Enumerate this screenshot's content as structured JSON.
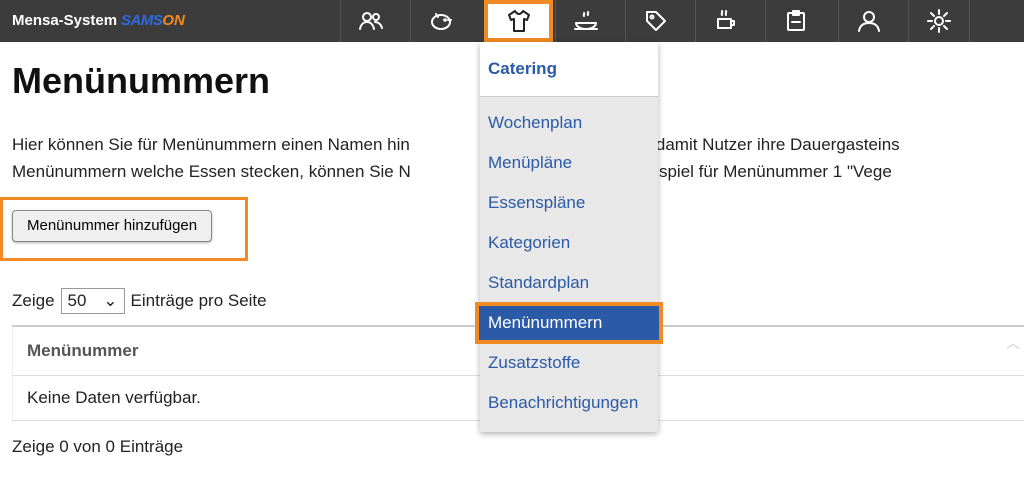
{
  "header": {
    "app_name": "Mensa-System",
    "logo_part1": "SAMS",
    "logo_part2": "ON",
    "nav_icons": [
      "people-icon",
      "piggy-bank-icon",
      "shirt-icon",
      "food-dish-icon",
      "tag-icon",
      "cup-icon",
      "clipboard-icon",
      "user-icon",
      "gear-icon"
    ],
    "active_nav": "shirt-icon"
  },
  "page": {
    "title": "Menünummern",
    "intro_line1": "Hier können Sie für Menünummern einen Namen hin",
    "intro_line1_right": "twendig, damit Nutzer ihre Dauergasteins",
    "intro_line2": "Menünummern welche Essen stecken, können Sie N",
    "intro_line2_right": "n. Zum Beispiel für Menünummer 1 \"Vege",
    "add_button": "Menünummer hinzufügen",
    "length_prefix": "Zeige",
    "length_value": "50",
    "length_suffix": "Einträge pro Seite",
    "table_header": "Menünummer",
    "empty_text": "Keine Daten verfügbar.",
    "info_text": "Zeige 0 von 0 Einträge"
  },
  "dropdown": {
    "heading": "Catering",
    "items": [
      "Wochenplan",
      "Menüpläne",
      "Essenspläne",
      "Kategorien",
      "Standardplan",
      "Menünummern",
      "Zusatzstoffe",
      "Benachrichtigungen"
    ],
    "active_item": "Menünummern"
  },
  "colors": {
    "accent": "#f08a24",
    "link": "#2b5aa6",
    "topbar": "#3c3c3c"
  }
}
